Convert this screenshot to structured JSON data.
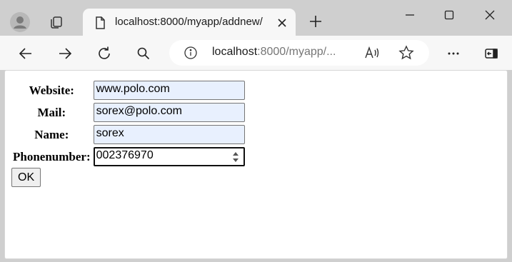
{
  "tab": {
    "title": "localhost:8000/myapp/addnew/"
  },
  "address_bar": {
    "host": "localhost",
    "rest": ":8000/myapp/..."
  },
  "form": {
    "fields": [
      {
        "label": "Website:",
        "value": "www.polo.com"
      },
      {
        "label": "Mail:",
        "value": "sorex@polo.com"
      },
      {
        "label": "Name:",
        "value": "sorex"
      },
      {
        "label": "Phonenumber:",
        "value": "002376970"
      }
    ],
    "submit_label": "OK"
  }
}
